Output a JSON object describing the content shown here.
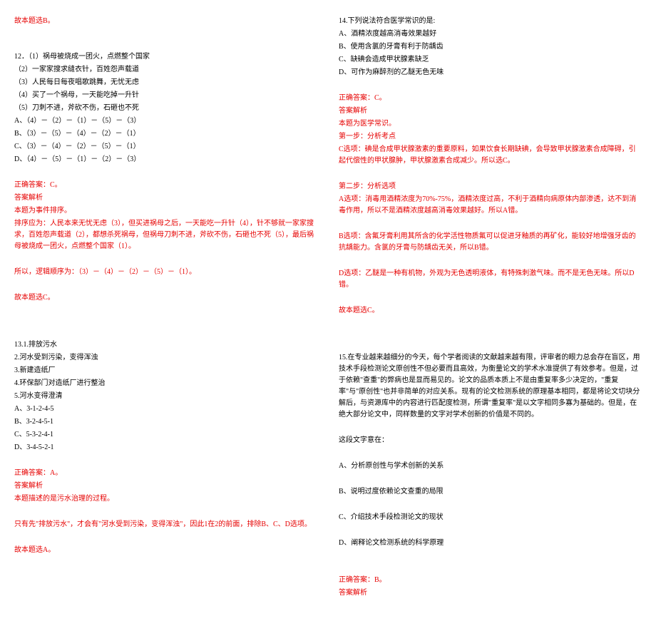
{
  "left": {
    "top_line": "故本题选B。",
    "q12": {
      "title": "12．（1）祸母被烧成一团火，点燃整个国家",
      "lines": [
        "（2）一家家搜求缝衣针，百姓怨声载道",
        "（3）人民每日每夜唱歌跳舞，无忧无虑",
        "（4）买了一个祸母，一天能吃掉一升针",
        "（5）刀刺不进，斧砍不伤，石砸也不死"
      ],
      "options": [
        "A、（4）－（2）－（1）－（5）－（3）",
        "B、（3）－（5）－（4）－（2）－（1）",
        "C、（3）－（4）－（2）－（5）－（1）",
        "D、（4）－（5）－（1）－（2）－（3）"
      ],
      "answer_label": "正确答案：C。",
      "analysis_label": "答案解析",
      "analysis_type": "本题为事件排序。",
      "analysis_text": "排序应为：人民本来无忧无虑（3），但买进祸母之后，一天能吃一升针（4），针不够就一家家搜求，百姓怨声载道（2），都想杀死祸母，但祸母刀刺不进，斧砍不伤，石砸也不死（5），最后祸母被烧成一团火，点燃整个国家（1）。",
      "conclusion": "所以，逻辑顺序为：（3）－（4）－（2）－（5）－（1）。",
      "final": "故本题选C。"
    },
    "q13": {
      "lines": [
        "13.1.排放污水",
        "2.河水受到污染，变得浑浊",
        "3.新建造纸厂",
        "4.环保部门对造纸厂进行整治",
        "5.河水变得澄清"
      ],
      "options": [
        "A、3-1-2-4-5",
        "B、3-2-4-5-1",
        "C、5-3-2-4-1",
        "D、3-4-5-2-1"
      ],
      "answer_label": "正确答案：A。",
      "analysis_label": "答案解析",
      "analysis_text": "本题描述的是污水治理的过程。",
      "analysis_text2": "只有先\"排放污水\"，才会有\"河水受到污染，变得浑浊\"，因此1在2的前面，排除B、C、D选项。",
      "final": "故本题选A。"
    }
  },
  "right": {
    "q14": {
      "title": "14.下列说法符合医学常识的是:",
      "options": [
        "A、酒精浓度越高消毒效果越好",
        "B、使用含氯的牙膏有利于防龋齿",
        "C、缺碘会造成甲状腺素缺乏",
        "D、可作为麻醉剂的乙醚无色无味"
      ],
      "answer_label": "正确答案：C。",
      "analysis_label": "答案解析",
      "analysis_lines": [
        "本题为医学常识。",
        "第一步：分析考点",
        "C选项：碘是合成甲状腺激素的重要原料，如果饮食长期缺碘，会导致甲状腺激素合成障碍，引起代偿性的甲状腺肿，甲状腺激素合成减少。所以选C。",
        "",
        "第二步：分析选项",
        "A选项：消毒用酒精浓度为70%-75%，酒精浓度过高，不利于酒精向病原体内部渗透，达不到消毒作用，所以不是酒精浓度越高消毒效果越好。所以A错。",
        "",
        "B选项：含氟牙膏利用其所含的化学活性物质氟可以促进牙釉质的再矿化，能较好地增强牙齿的抗龋能力。含氯的牙膏与防龋齿无关，所以B错。",
        "",
        "D选项：乙醚是一种有机物，外观为无色透明液体，有特殊刺激气味。而不是无色无味。所以D错。",
        "",
        "故本题选C。"
      ]
    },
    "q15": {
      "text": "15.在专业越来越细分的今天，每个学者阅读的文献越来越有限，评审者的眼力总会存在盲区，用技术手段检测论文原创性不但必要而且高效，为衡量论文的学术水准提供了有效参考。但是，过于依赖\"查重\"的弊病也是显而易见的。论文的品质本质上不是由重复率多少决定的，\"重复率\"与\"原创性\"也并非简单的对应关系。现有的论文检测系统的原理基本相同，都是将论文切块分解后，与资源库中的内容进行匹配度检测，所谓\"重复率\"是以文字相同多寡为基础的。但是，在绝大部分论文中，同样数量的文字对学术创新的价值是不同的。",
      "stem": "这段文字意在：",
      "options": [
        "A、分析原创性与学术创新的关系",
        "B、说明过度依赖论文查重的局限",
        "C、介绍技术手段检测论文的现状",
        "D、阐释论文检测系统的科学原理"
      ],
      "answer_label": "正确答案：B。",
      "analysis_label": "答案解析"
    }
  }
}
